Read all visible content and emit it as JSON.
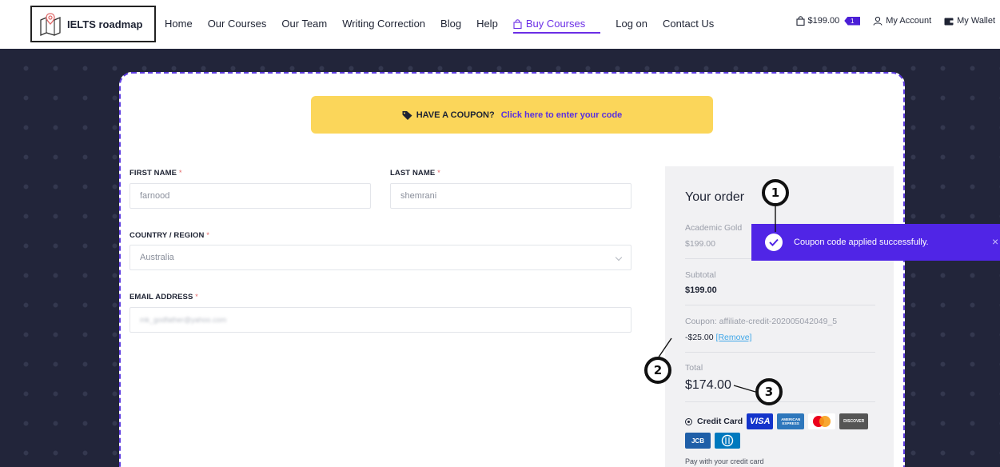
{
  "header": {
    "logo_text": "IELTS roadmap",
    "nav": [
      "Home",
      "Our Courses",
      "Our Team",
      "Writing Correction",
      "Blog",
      "Help"
    ],
    "active_nav": "Buy Courses",
    "nav_after": [
      "Log on",
      "Contact Us"
    ],
    "cart_total": "$199.00",
    "cart_count": "1",
    "my_account": "My Account",
    "my_wallet": "My Wallet",
    "accent_color": "#6b2ee6"
  },
  "coupon_bar": {
    "prompt": "HAVE A COUPON?",
    "link": "Click here to enter your code",
    "icon": "tag-icon"
  },
  "form": {
    "first_name_label": "FIRST NAME",
    "first_name_value": "farnood",
    "last_name_label": "LAST NAME",
    "last_name_value": "shemrani",
    "country_label": "COUNTRY / REGION",
    "country_value": "Australia",
    "email_label": "EMAIL ADDRESS",
    "email_value": "mk_godfather@yahoo.com",
    "required_mark": "*"
  },
  "order": {
    "title": "Your order",
    "product_name": "Academic Gold",
    "product_price": "$199.00",
    "subtotal_label": "Subtotal",
    "subtotal_value": "$199.00",
    "coupon_label": "Coupon: affiliate-credit-202005042049_5",
    "coupon_discount": "-$25.00",
    "remove_link": "[Remove]",
    "total_label": "Total",
    "total_value": "$174.00",
    "payment_method": "Credit Card",
    "card_brands": [
      "VISA",
      "AMERICAN EXPRESS",
      "Mastercard",
      "DISCOVER",
      "JCB",
      "Diners Club"
    ],
    "pay_note": "Pay with your credit card"
  },
  "toast": {
    "message": "Coupon code applied successfully.",
    "close": "×",
    "color": "#5025e6"
  },
  "annotations": [
    "1",
    "2",
    "3"
  ]
}
